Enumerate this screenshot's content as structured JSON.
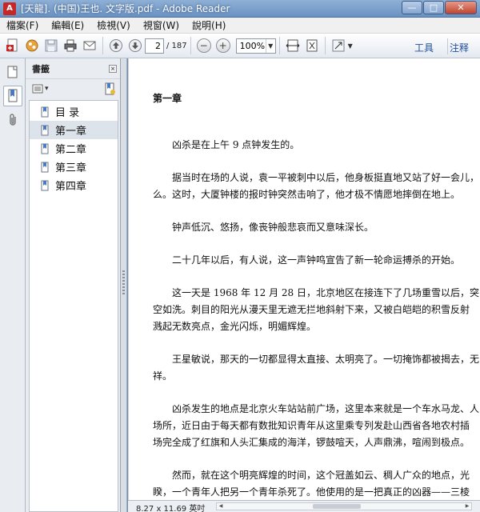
{
  "window": {
    "title": "[天龍]. (中国)王也. 文字版.pdf - Adobe Reader",
    "app_icon_glyph": "A",
    "minimize_glyph": "—",
    "maximize_glyph": "□",
    "close_glyph": "✕"
  },
  "menu": {
    "items": [
      "檔案(F)",
      "編輯(E)",
      "檢視(V)",
      "視窗(W)",
      "說明(H)"
    ]
  },
  "toolbar": {
    "current_page": "2",
    "total_pages": "/ 187",
    "zoom_out_glyph": "−",
    "zoom_in_glyph": "+",
    "zoom_value": "100%",
    "zoom_dropdown_glyph": "▼",
    "tools_label": "工具",
    "comment_label": "注释"
  },
  "bookmarks_panel": {
    "title": "書籤",
    "close_glyph": "×",
    "options_glyph": "▾",
    "items": [
      {
        "label": "目 录",
        "selected": false
      },
      {
        "label": "第一章",
        "selected": true
      },
      {
        "label": "第二章",
        "selected": false
      },
      {
        "label": "第三章",
        "selected": false
      },
      {
        "label": "第四章",
        "selected": false
      }
    ]
  },
  "document": {
    "chapter_title": "第一章",
    "paragraphs": [
      [
        "凶杀是在上午 9 点钟发生的。"
      ],
      [
        "据当时在场的人说，袁一平被刺中以后，他身板挺直地又站了好一会儿，",
        "么。这时，大厦钟楼的报时钟突然击响了，他才极不情愿地摔倒在地上。"
      ],
      [
        "钟声低沉、悠扬，像丧钟般悲哀而又意味深长。"
      ],
      [
        "二十几年以后，有人说，这一声钟鸣宣告了新一轮命运搏杀的开始。"
      ],
      [
        "这一天是 1968 年 12 月 28 日，北京地区在接连下了几场重雪以后，突",
        "空如洗。刺目的阳光从漫天里无遮无拦地斜射下来，又被白皑皑的积雪反射",
        "溅起无数亮点，金光闪烁，明媚辉煌。"
      ],
      [
        "王星敏说，那天的一切都显得太直接、太明亮了。一切掩饰都被揭去，无",
        "祥。"
      ],
      [
        "凶杀发生的地点是北京火车站站前广场，这里本来就是一个车水马龙、人",
        "场所，近日由于每天都有数批知识青年从这里乘专列发赴山西省各地农村插",
        "场完全成了红旗和人头汇集成的海洋，锣鼓喧天，人声鼎沸，喧闹到极点。"
      ],
      [
        "然而，就在这个明亮辉煌的时间，这个冠盖如云、稠人广众的地点，光",
        "睽，一个青年人把另一个青年杀死了。他使用的是一把真正的凶器——三棱"
      ]
    ]
  },
  "status": {
    "page_size": "8.27 x 11.69 英吋",
    "scroll_left_glyph": "◀",
    "scroll_right_glyph": "▶"
  }
}
